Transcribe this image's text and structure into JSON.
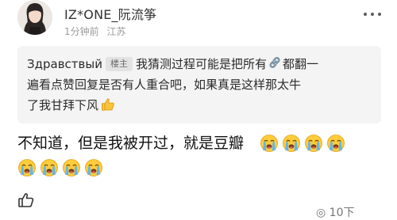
{
  "post": {
    "author": "IZ*ONE_阮流筝",
    "time": "1分钟前",
    "location": "江苏"
  },
  "quote": {
    "username": "Здравствый",
    "badge": "楼主",
    "line1_before_link": "我猜测过程可能是把所有",
    "line1_after_link": "都翻一",
    "line2": "遍看点赞回复是否有人重合吧，如果真是这样那太牛",
    "line3": "了我甘拜下风"
  },
  "reply": {
    "text": "不知道，但是我被开过，就是豆瓣",
    "emoji_name": "loudly-crying-face"
  },
  "actions": {
    "like_count_partial": "◎ 10下"
  },
  "icons": {
    "more": "more-dots-icon",
    "link": "link-icon",
    "thumbs_up": "thumbs-up-icon",
    "like": "like-icon"
  }
}
